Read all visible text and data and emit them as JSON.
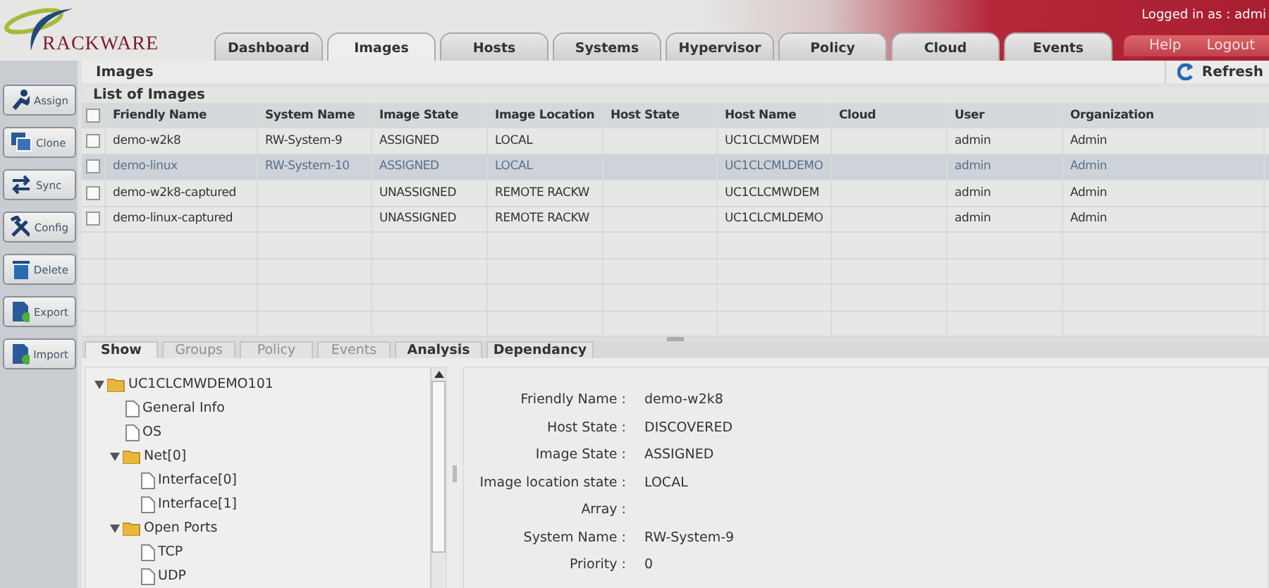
{
  "header": {
    "logo_text": "RACKWARE",
    "login": "Logged in as : admi",
    "links": [
      "Help",
      "Logout"
    ]
  },
  "tabs": [
    {
      "label": "Dashboard",
      "selected": false
    },
    {
      "label": "Images",
      "selected": true
    },
    {
      "label": "Hosts",
      "selected": false
    },
    {
      "label": "Systems",
      "selected": false
    },
    {
      "label": "Hypervisor",
      "selected": false
    },
    {
      "label": "Policy",
      "selected": false
    },
    {
      "label": "Cloud",
      "selected": false
    },
    {
      "label": "Events",
      "selected": false
    }
  ],
  "sidebar": {
    "items": [
      {
        "label": "Assign"
      },
      {
        "label": "Clone"
      },
      {
        "label": "Sync"
      },
      {
        "label": "Config"
      },
      {
        "label": "Delete"
      },
      {
        "label": "Export"
      },
      {
        "label": "Import"
      }
    ]
  },
  "page_title": "Images",
  "refresh": "Refresh",
  "table_title": "List of Images",
  "table": {
    "all_checked": false,
    "columns": [
      "Friendly Name",
      "System Name",
      "Image State",
      "Image Location",
      "Host State",
      "Host Name",
      "Cloud",
      "User",
      "Organization"
    ],
    "rows": [
      {
        "selected": false,
        "checked": false,
        "cells": [
          "demo-w2k8",
          "RW-System-9",
          "ASSIGNED",
          "LOCAL",
          "",
          "UC1CLCMWDEM",
          "",
          "admin",
          "Admin"
        ]
      },
      {
        "selected": true,
        "checked": false,
        "cells": [
          "demo-linux",
          "RW-System-10",
          "ASSIGNED",
          "LOCAL",
          "",
          "UC1CLCMLDEMO",
          "",
          "admin",
          "Admin"
        ]
      },
      {
        "selected": false,
        "checked": false,
        "cells": [
          "demo-w2k8-captured",
          "",
          "UNASSIGNED",
          "REMOTE RACKW",
          "",
          "UC1CLCMWDEM",
          "",
          "admin",
          "Admin"
        ]
      },
      {
        "selected": false,
        "checked": false,
        "cells": [
          "demo-linux-captured",
          "",
          "UNASSIGNED",
          "REMOTE RACKW",
          "",
          "UC1CLCMLDEMO",
          "",
          "admin",
          "Admin"
        ]
      }
    ]
  },
  "detail_tabs": [
    {
      "label": "Show",
      "selected": true,
      "disabled": false
    },
    {
      "label": "Groups",
      "selected": false,
      "disabled": true
    },
    {
      "label": "Policy",
      "selected": false,
      "disabled": true
    },
    {
      "label": "Events",
      "selected": false,
      "disabled": true
    },
    {
      "label": "Analysis",
      "selected": false,
      "disabled": false
    },
    {
      "label": "Dependancy",
      "selected": false,
      "disabled": false
    }
  ],
  "tree": [
    {
      "label": "UC1CLCMWDEMO101",
      "kind": "folder",
      "expanded": true,
      "children": [
        {
          "label": "General Info",
          "kind": "file"
        },
        {
          "label": "OS",
          "kind": "file"
        },
        {
          "label": "Net[0]",
          "kind": "folder",
          "expanded": true,
          "children": [
            {
              "label": "Interface[0]",
              "kind": "file"
            },
            {
              "label": "Interface[1]",
              "kind": "file"
            }
          ]
        },
        {
          "label": "Open Ports",
          "kind": "folder",
          "expanded": true,
          "children": [
            {
              "label": "TCP",
              "kind": "file"
            },
            {
              "label": "UDP",
              "kind": "file"
            }
          ]
        }
      ]
    }
  ],
  "details": [
    {
      "label": "Friendly Name :",
      "value": "demo-w2k8"
    },
    {
      "label": "Host State :",
      "value": "DISCOVERED"
    },
    {
      "label": "Image State :",
      "value": "ASSIGNED"
    },
    {
      "label": "Image location state :",
      "value": "LOCAL"
    },
    {
      "label": "Array :"
    },
    {
      "label": "System Name :",
      "value": "RW-System-9"
    },
    {
      "label": "Priority :",
      "value": "0"
    }
  ]
}
